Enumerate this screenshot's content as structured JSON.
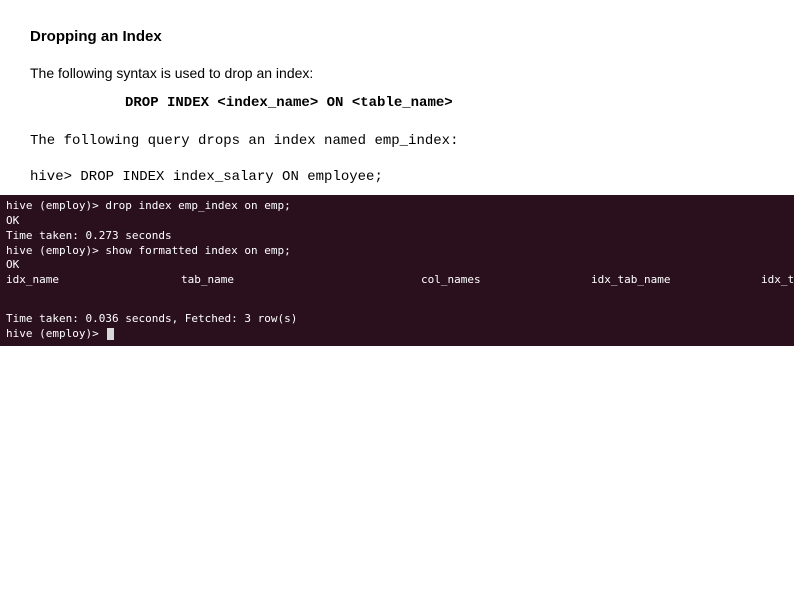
{
  "heading": "Dropping an Index",
  "intro": "The following syntax is used to drop an index:",
  "syntax": "DROP INDEX <index_name> ON <table_name>",
  "desc": "The following query drops an index named emp_index:",
  "query": "hive> DROP INDEX index_salary ON employee;",
  "terminal": {
    "line1": "hive (employ)> drop index emp_index on emp;",
    "line2": "OK",
    "line3": "Time taken: 0.273 seconds",
    "line4": "hive (employ)> show formatted index on emp;",
    "line5": "OK",
    "cols": {
      "c1": "idx_name",
      "c2": "tab_name",
      "c3": "col_names",
      "c4": "idx_tab_name",
      "c5": "idx_type"
    },
    "line7": "Time taken: 0.036 seconds, Fetched: 3 row(s)",
    "line8": "hive (employ)> "
  }
}
